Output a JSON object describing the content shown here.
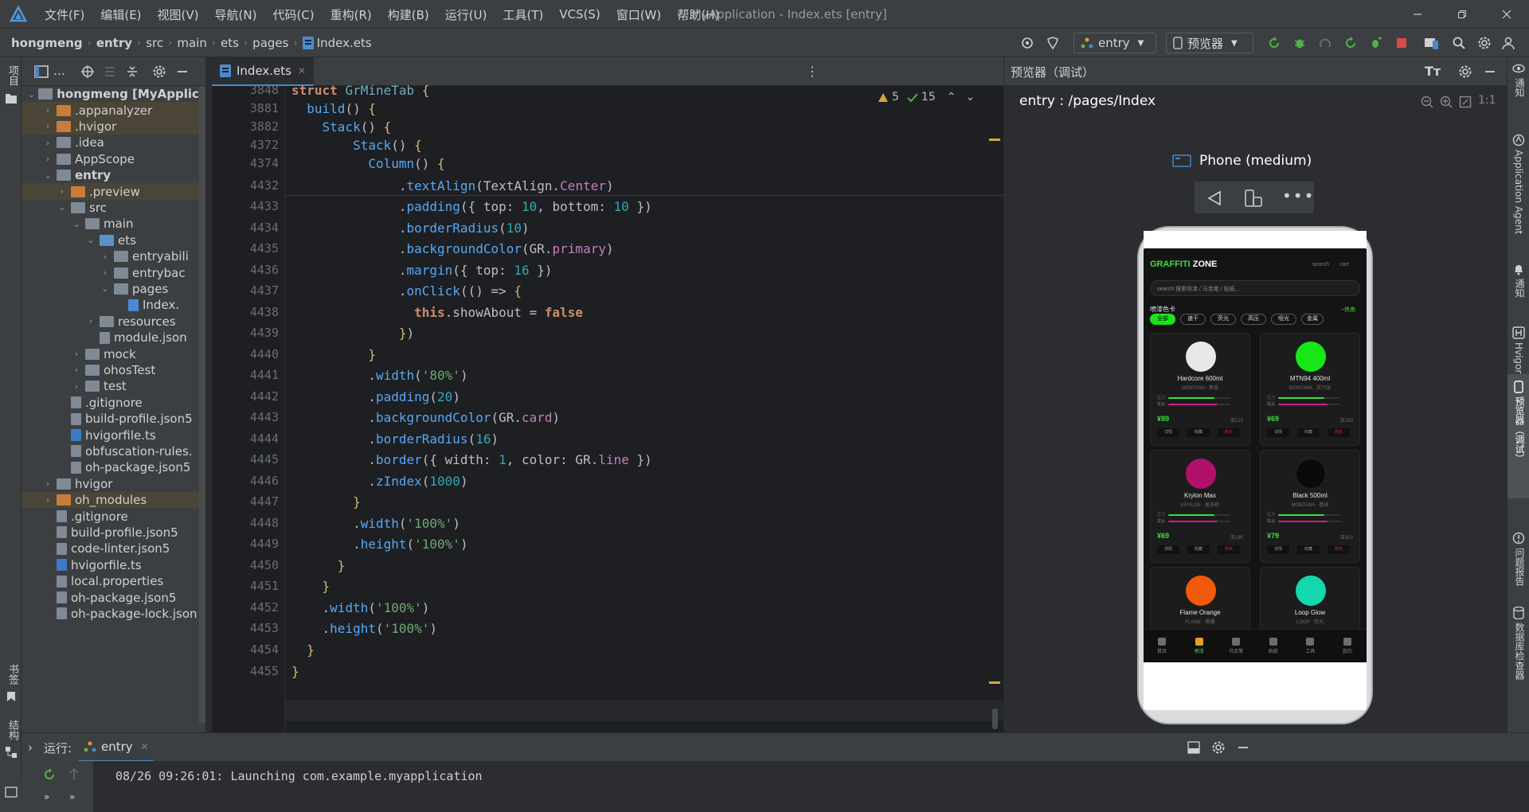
{
  "menu": [
    "文件(F)",
    "编辑(E)",
    "视图(V)",
    "导航(N)",
    "代码(C)",
    "重构(R)",
    "构建(B)",
    "运行(U)",
    "工具(T)",
    "VCS(S)",
    "窗口(W)",
    "帮助(H)"
  ],
  "window_title": "MyApplication - Index.ets [entry]",
  "breadcrumb": [
    "hongmeng",
    "entry",
    "src",
    "main",
    "ets",
    "pages",
    "Index.ets"
  ],
  "toolbar": {
    "module_combo": "entry",
    "preview_combo": "预览器"
  },
  "left_strip": {
    "project": "项目",
    "bookmarks": "书签",
    "structure": "结构"
  },
  "project_tree": [
    {
      "label": "hongmeng [MyApplicati",
      "bold": true,
      "depth": 0,
      "chev": "v",
      "icon": "folder"
    },
    {
      "label": ".appanalyzer",
      "depth": 1,
      "chev": ">",
      "icon": "folder-orange",
      "sel": true
    },
    {
      "label": ".hvigor",
      "depth": 1,
      "chev": ">",
      "icon": "folder-orange",
      "sel": true
    },
    {
      "label": ".idea",
      "depth": 1,
      "chev": ">",
      "icon": "folder"
    },
    {
      "label": "AppScope",
      "depth": 1,
      "chev": ">",
      "icon": "folder"
    },
    {
      "label": "entry",
      "bold": true,
      "depth": 1,
      "chev": "v",
      "icon": "folder"
    },
    {
      "label": ".preview",
      "depth": 2,
      "chev": ">",
      "icon": "folder-orange",
      "sel": true
    },
    {
      "label": "src",
      "depth": 2,
      "chev": "v",
      "icon": "folder"
    },
    {
      "label": "main",
      "depth": 3,
      "chev": "v",
      "icon": "folder"
    },
    {
      "label": "ets",
      "depth": 4,
      "chev": "v",
      "icon": "folder-blue"
    },
    {
      "label": "entryabili",
      "depth": 5,
      "chev": ">",
      "icon": "folder"
    },
    {
      "label": "entrybac",
      "depth": 5,
      "chev": ">",
      "icon": "folder"
    },
    {
      "label": "pages",
      "depth": 5,
      "chev": "v",
      "icon": "folder"
    },
    {
      "label": "Index.",
      "depth": 6,
      "chev": "",
      "icon": "file-ets"
    },
    {
      "label": "resources",
      "depth": 4,
      "chev": ">",
      "icon": "folder"
    },
    {
      "label": "module.json",
      "depth": 4,
      "chev": "",
      "icon": "file"
    },
    {
      "label": "mock",
      "depth": 3,
      "chev": ">",
      "icon": "folder"
    },
    {
      "label": "ohosTest",
      "depth": 3,
      "chev": ">",
      "icon": "folder"
    },
    {
      "label": "test",
      "depth": 3,
      "chev": ">",
      "icon": "folder"
    },
    {
      "label": ".gitignore",
      "depth": 2,
      "chev": "",
      "icon": "file"
    },
    {
      "label": "build-profile.json5",
      "depth": 2,
      "chev": "",
      "icon": "file"
    },
    {
      "label": "hvigorfile.ts",
      "depth": 2,
      "chev": "",
      "icon": "file-ts"
    },
    {
      "label": "obfuscation-rules.",
      "depth": 2,
      "chev": "",
      "icon": "file"
    },
    {
      "label": "oh-package.json5",
      "depth": 2,
      "chev": "",
      "icon": "file"
    },
    {
      "label": "hvigor",
      "depth": 1,
      "chev": ">",
      "icon": "folder"
    },
    {
      "label": "oh_modules",
      "depth": 1,
      "chev": ">",
      "icon": "folder-orange",
      "sel": true
    },
    {
      "label": ".gitignore",
      "depth": 1,
      "chev": "",
      "icon": "file"
    },
    {
      "label": "build-profile.json5",
      "depth": 1,
      "chev": "",
      "icon": "file"
    },
    {
      "label": "code-linter.json5",
      "depth": 1,
      "chev": "",
      "icon": "file"
    },
    {
      "label": "hvigorfile.ts",
      "depth": 1,
      "chev": "",
      "icon": "file-ts"
    },
    {
      "label": "local.properties",
      "depth": 1,
      "chev": "",
      "icon": "file"
    },
    {
      "label": "oh-package.json5",
      "depth": 1,
      "chev": "",
      "icon": "file"
    },
    {
      "label": "oh-package-lock.json",
      "depth": 1,
      "chev": "",
      "icon": "file"
    }
  ],
  "editor_tab": "Index.ets",
  "inspections": {
    "warnings": "5",
    "weak": "15"
  },
  "code_lines": [
    {
      "n": "3848",
      "html": "<span class='kw'>struct</span> <span class='ty'>GrMineTab</span> <span class='yel'>{</span>"
    },
    {
      "n": "3881",
      "html": "  <span class='fn'>build</span>() <span class='yel'>{</span>"
    },
    {
      "n": "3882",
      "html": "    <span class='fn'>Stack</span>() <span class='yel'>{</span>"
    },
    {
      "n": "4372",
      "html": "        <span class='fn'>Stack</span>() <span class='yel'>{</span>"
    },
    {
      "n": "4374",
      "html": "          <span class='fn'>Column</span>() <span class='yel'>{</span>"
    },
    {
      "n": "4432",
      "html": "              .<span class='fn'>textAlign</span>(TextAlign.<span class='pr'>Center</span>)"
    },
    {
      "n": "4433",
      "html": "              .<span class='fn'>padding</span>({ top: <span class='nm'>10</span>, bottom: <span class='nm'>10</span> })"
    },
    {
      "n": "4434",
      "html": "              .<span class='fn'>borderRadius</span>(<span class='nm'>10</span>)"
    },
    {
      "n": "4435",
      "html": "              .<span class='fn'>backgroundColor</span>(GR.<span class='pr'>primary</span>)"
    },
    {
      "n": "4436",
      "html": "              .<span class='fn'>margin</span>({ top: <span class='nm'>16</span> })"
    },
    {
      "n": "4437",
      "html": "              .<span class='fn'>onClick</span>(() => <span class='yel'>{</span>"
    },
    {
      "n": "4438",
      "html": "                <span class='kw'>this</span>.showAbout = <span class='kw'>false</span>"
    },
    {
      "n": "4439",
      "html": "              <span class='yel'>}</span>)"
    },
    {
      "n": "4440",
      "html": "          <span class='yel'>}</span>"
    },
    {
      "n": "4441",
      "html": "          .<span class='fn'>width</span>(<span class='st'>'80%'</span>)"
    },
    {
      "n": "4442",
      "html": "          .<span class='fn'>padding</span>(<span class='nm'>20</span>)"
    },
    {
      "n": "4443",
      "html": "          .<span class='fn'>backgroundColor</span>(GR.<span class='pr'>card</span>)"
    },
    {
      "n": "4444",
      "html": "          .<span class='fn'>borderRadius</span>(<span class='nm'>16</span>)"
    },
    {
      "n": "4445",
      "html": "          .<span class='fn'>border</span>({ width: <span class='nm'>1</span>, color: GR.<span class='pr'>line</span> })"
    },
    {
      "n": "4446",
      "html": "          .<span class='fn'>zIndex</span>(<span class='nm'>1000</span>)"
    },
    {
      "n": "4447",
      "html": "        <span class='yel'>}</span>"
    },
    {
      "n": "4448",
      "html": "        .<span class='fn'>width</span>(<span class='st'>'100%'</span>)"
    },
    {
      "n": "4449",
      "html": "        .<span class='fn'>height</span>(<span class='st'>'100%'</span>)"
    },
    {
      "n": "4450",
      "html": "      <span class='yel'>}</span>"
    },
    {
      "n": "4451",
      "html": "    <span class='yel'>}</span>"
    },
    {
      "n": "4452",
      "html": "    .<span class='fn'>width</span>(<span class='st'>'100%'</span>)"
    },
    {
      "n": "4453",
      "html": "    .<span class='fn'>height</span>(<span class='st'>'100%'</span>)"
    },
    {
      "n": "4454",
      "html": "  <span class='yel'>}</span>"
    },
    {
      "n": "4455",
      "html": "<span class='yel'>}</span>"
    }
  ],
  "preview": {
    "header": "预览器（调试）",
    "route": "entry : /pages/Index",
    "device": "Phone (medium)",
    "zoom": "1:1",
    "app": {
      "brand_green": "GRAFFITI",
      "brand_white": " ZONE",
      "top_links": [
        "search",
        "cart"
      ],
      "search_placeholder": "search 搜索喷漆 / 马克笔 / 贴纸...",
      "section_title": "喷漆色卡",
      "section_action": "~热卖",
      "chips": [
        "全部",
        "速干",
        "荧光",
        "高压",
        "哑光",
        "金属"
      ],
      "cards": [
        {
          "name": "Hardcore 600ml",
          "sub": "MONTANA · 新品",
          "price": "¥89",
          "stock": "库120",
          "color": "#e8e8e8",
          "bar": "#3ee03e",
          "bar2": "#d21a8a"
        },
        {
          "name": "MTN94 400ml",
          "sub": "MONTANA · 实力派",
          "price": "¥69",
          "stock": "库293",
          "color": "#19e619",
          "bar": "#3ee03e",
          "bar2": "#d21a8a"
        },
        {
          "name": "Krylon Max",
          "sub": "KRYLON · 美系经",
          "price": "¥69",
          "stock": "库195",
          "color": "#b0106a",
          "bar": "#3ee03e",
          "bar2": "#d21a8a"
        },
        {
          "name": "Black 500ml",
          "sub": "MONTANA · 基础",
          "price": "¥79",
          "stock": "库413",
          "color": "#0a0a0a",
          "bar": "#3ee03e",
          "bar2": "#d21a8a"
        },
        {
          "name": "Flame Orange",
          "sub": "FLAME · 橙爆",
          "price": "",
          "stock": "",
          "color": "#f05a0a",
          "bar": "#3ee03e",
          "bar2": "#d21a8a"
        },
        {
          "name": "Loop Glow",
          "sub": "LOOP · 荧光",
          "price": "",
          "stock": "",
          "color": "#14d9b0",
          "bar": "#3ee03e",
          "bar2": "#d21a8a"
        }
      ],
      "card_buttons": [
        "详情",
        "收藏",
        "购买"
      ],
      "card_meters": [
        "压力",
        "覆盖"
      ],
      "bottom_nav": [
        "首页",
        "喷漆",
        "马克笔",
        "贴纸",
        "工具",
        "我的"
      ]
    }
  },
  "right_strip": [
    "通知",
    "Application Agent",
    "通知",
    "Hvigor",
    "预览器（调试）",
    "问题报告",
    "数据库检查器"
  ],
  "run": {
    "label": "运行:",
    "config": "entry",
    "log": "08/26 09:26:01: Launching com.example.myapplication"
  }
}
